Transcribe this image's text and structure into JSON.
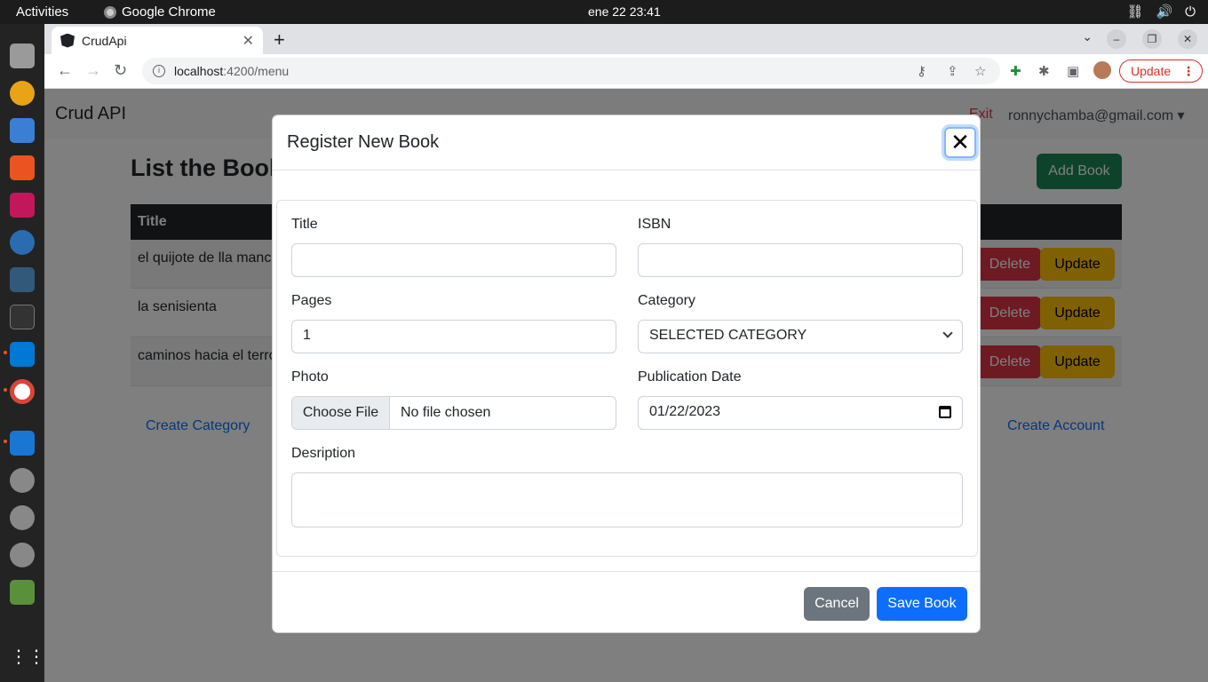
{
  "os": {
    "activities": "Activities",
    "app_name": "Google Chrome",
    "clock": "ene 22  23:41"
  },
  "browser": {
    "tab_title": "CrudApi",
    "url_host": "localhost",
    "url_path": ":4200/menu",
    "update_label": "Update"
  },
  "app": {
    "brand": "Crud API",
    "exit_label": "Exit",
    "user_email": "ronnychamba@gmail.com",
    "page_title": "List the Books",
    "add_book_label": "Add Book",
    "table_header_title": "Title",
    "rows": [
      {
        "title": "el quijote de lla mancha",
        "delete_label": "Delete",
        "update_label": "Update"
      },
      {
        "title": "la senisienta",
        "delete_label": "Delete",
        "update_label": "Update"
      },
      {
        "title": "caminos hacia el terror",
        "delete_label": "Delete",
        "update_label": "Update"
      }
    ],
    "create_category_label": "Create Category",
    "create_account_label": "Create Account"
  },
  "modal": {
    "title": "Register New Book",
    "close_glyph": "✕",
    "title_label": "Title",
    "title_value": "",
    "isbn_label": "ISBN",
    "isbn_value": "",
    "pages_label": "Pages",
    "pages_value": "1",
    "category_label": "Category",
    "category_selected": "SELECTED CATEGORY",
    "photo_label": "Photo",
    "choose_file_label": "Choose File",
    "no_file_text": "No file chosen",
    "pubdate_label": "Publication Date",
    "pubdate_value": "01/22/2023",
    "description_label": "Desription",
    "description_value": "",
    "cancel_label": "Cancel",
    "save_label": "Save Book"
  },
  "colors": {
    "primary": "#0d6efd",
    "success": "#198754",
    "danger": "#dc3545",
    "warning": "#ffc107",
    "secondary": "#6c757d"
  }
}
